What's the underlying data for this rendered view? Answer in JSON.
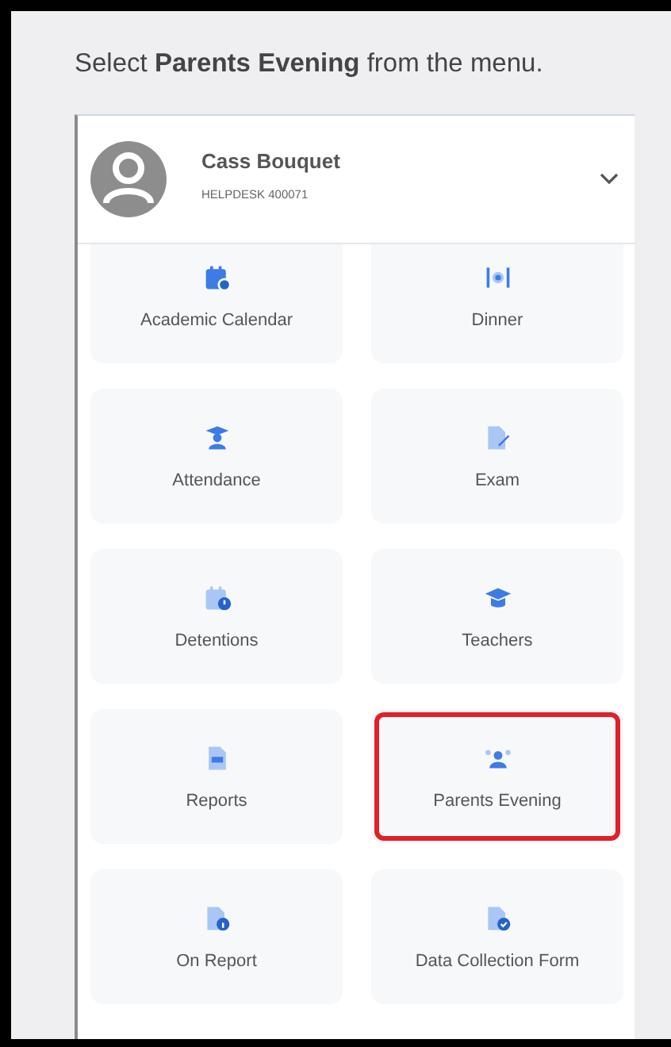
{
  "instruction": "Select **Parents Evening** from the menu.",
  "profile": {
    "name": "Cass Bouquet",
    "subtitle": "HELPDESK 400071",
    "expanded": false
  },
  "menu_items": [
    {
      "label": "Academic Calendar",
      "highlighted": false
    },
    {
      "label": "Dinner",
      "highlighted": false
    },
    {
      "label": "Attendance",
      "highlighted": false
    },
    {
      "label": "Exam",
      "highlighted": false
    },
    {
      "label": "Detentions",
      "highlighted": false
    },
    {
      "label": "Teachers",
      "highlighted": false
    },
    {
      "label": "Reports",
      "highlighted": false
    },
    {
      "label": "Parents Evening",
      "highlighted": true
    },
    {
      "label": "On Report",
      "highlighted": false
    },
    {
      "label": "Data Collection Form",
      "highlighted": false
    }
  ]
}
